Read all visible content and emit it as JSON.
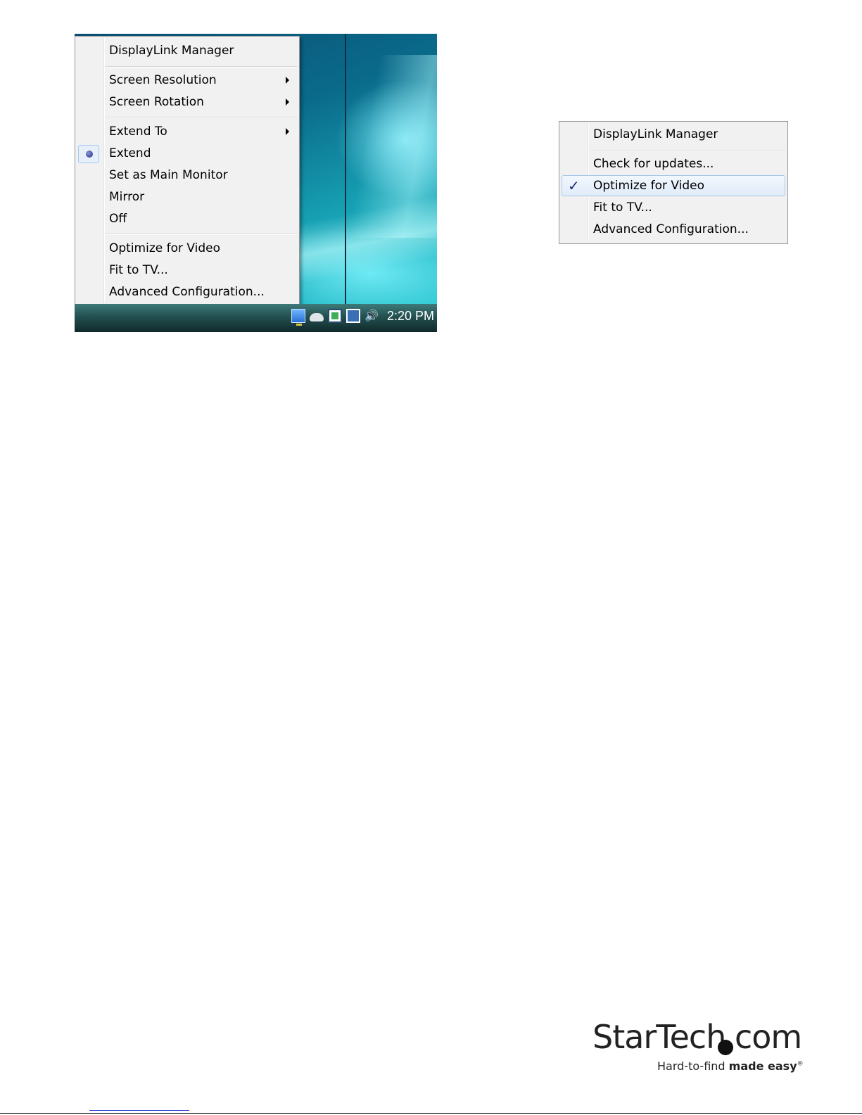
{
  "left_screenshot": {
    "menu": {
      "items": [
        {
          "label": "DisplayLink Manager"
        },
        {
          "label": "Screen Resolution",
          "submenu": true
        },
        {
          "label": "Screen Rotation",
          "submenu": true
        },
        {
          "label": "Extend To",
          "submenu": true
        },
        {
          "label": "Extend",
          "selected": true
        },
        {
          "label": "Set as Main Monitor"
        },
        {
          "label": "Mirror"
        },
        {
          "label": "Off"
        },
        {
          "label": "Optimize for Video"
        },
        {
          "label": "Fit to TV..."
        },
        {
          "label": "Advanced Configuration..."
        }
      ]
    },
    "taskbar": {
      "tray_icons": [
        "network-icon",
        "cloud-icon",
        "monitor-status-icon",
        "displaylink-icon",
        "speaker-icon"
      ],
      "clock": "2:20 PM"
    }
  },
  "right_menu": {
    "items": [
      {
        "label": "DisplayLink Manager"
      },
      {
        "label": "Check for updates..."
      },
      {
        "label": "Optimize for Video",
        "checked": true
      },
      {
        "label": "Fit to TV..."
      },
      {
        "label": "Advanced Configuration..."
      }
    ]
  },
  "logo": {
    "wordmark_a": "StarTech",
    "wordmark_b": "com",
    "tagline_a": "Hard-to-find",
    "tagline_b": "made easy",
    "reg": "®"
  },
  "colors": {
    "menu_bg": "#f1f1f1",
    "highlight_border": "#a8c8ea",
    "radio_dot": "#1f2a7a",
    "desktop_teal": "#17a3b5"
  }
}
